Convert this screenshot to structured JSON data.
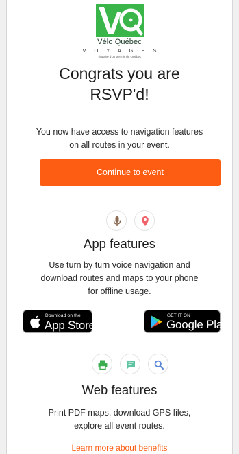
{
  "logo": {
    "name": "Vélo Québec",
    "sub": "V O Y A G E S",
    "tagline": "Titulaire d'un permis du Québec",
    "brand_color": "#39b54a"
  },
  "header": {
    "title_line1": "Congrats you are",
    "title_line2": "RSVP'd!"
  },
  "intro": {
    "line1": "You now have access to navigation features",
    "line2": "on all routes in your event."
  },
  "cta": {
    "label": "Continue to event",
    "color": "#fc5d12"
  },
  "app_features": {
    "icons": [
      "microphone-icon",
      "map-pin-icon"
    ],
    "title": "App features",
    "line1": "Use turn by turn voice navigation and",
    "line2": "download routes and maps to your phone",
    "line3": "for offline usage."
  },
  "stores": {
    "apple_small": "Download on the",
    "apple_big": "App Store",
    "google_small": "GET IT ON",
    "google_big": "Google Play"
  },
  "web_features": {
    "icons": [
      "printer-icon",
      "chat-icon",
      "search-icon"
    ],
    "title": "Web features",
    "line1": "Print PDF maps, download GPS files,",
    "line2": "explore all event routes."
  },
  "footer": {
    "learn_more": "Learn more about benefits"
  }
}
